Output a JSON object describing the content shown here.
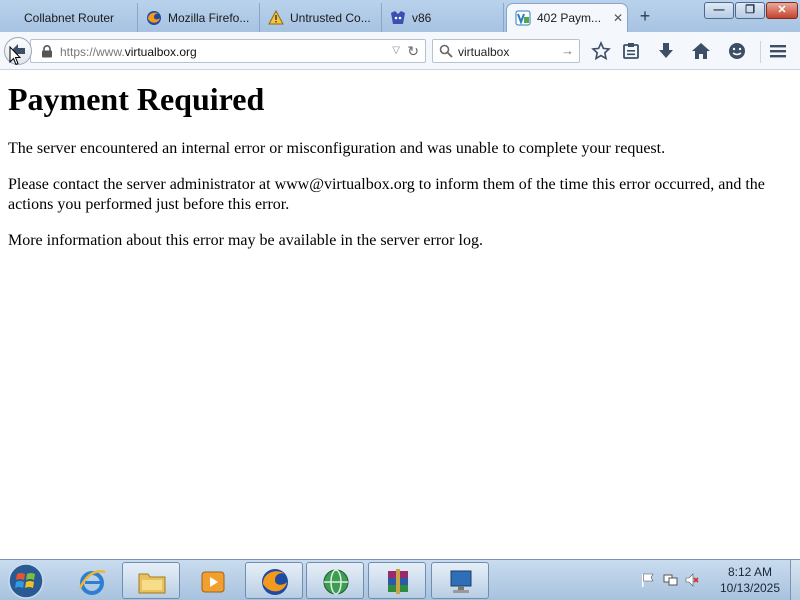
{
  "browser": {
    "tabs": [
      {
        "label": "Collabnet Router",
        "icon": "none",
        "active": false
      },
      {
        "label": "Mozilla Firefo...",
        "icon": "firefox-icon",
        "active": false
      },
      {
        "label": "Untrusted Co...",
        "icon": "warning-icon",
        "active": false
      },
      {
        "label": "v86",
        "icon": "v86-icon",
        "active": false
      },
      {
        "label": "402 Paym...",
        "icon": "virtualbox-icon",
        "active": true
      }
    ],
    "new_tab_label": "+",
    "window_buttons": {
      "minimize": "—",
      "maximize": "❐",
      "close": "✕"
    },
    "url": {
      "scheme_prefix": "https://www.",
      "host": "virtualbox.org"
    },
    "search": {
      "query": "virtualbox"
    }
  },
  "page": {
    "heading": "Payment Required",
    "paragraphs": [
      "The server encountered an internal error or misconfiguration and was unable to complete your request.",
      "Please contact the server administrator at www@virtualbox.org to inform them of the time this error occurred, and the actions you performed just before this error.",
      "More information about this error may be available in the server error log."
    ]
  },
  "taskbar": {
    "clock_time": "8:12 AM",
    "clock_date": "10/13/2025"
  },
  "colors": {
    "tab_strip": "#b9d2ec",
    "taskbar": "#b5cbe3",
    "close_button": "#c5432c"
  }
}
